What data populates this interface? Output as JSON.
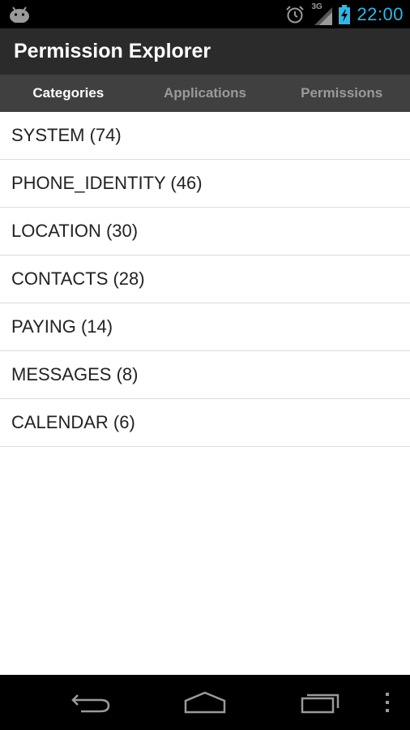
{
  "status_bar": {
    "time": "22:00",
    "network_label": "3G",
    "icons": [
      "android-icon",
      "alarm-icon",
      "signal-icon",
      "battery-charging-icon"
    ],
    "time_color": "#33b5e5"
  },
  "action_bar": {
    "title": "Permission Explorer",
    "background": "#2b2b2b"
  },
  "tabs": [
    {
      "label": "Categories",
      "active": true
    },
    {
      "label": "Applications",
      "active": false
    },
    {
      "label": "Permissions",
      "active": false
    }
  ],
  "categories": [
    {
      "label": "SYSTEM (74)"
    },
    {
      "label": "PHONE_IDENTITY (46)"
    },
    {
      "label": "LOCATION (30)"
    },
    {
      "label": "CONTACTS (28)"
    },
    {
      "label": "PAYING (14)"
    },
    {
      "label": "MESSAGES (8)"
    },
    {
      "label": "CALENDAR (6)"
    }
  ],
  "nav_bar": {
    "buttons": [
      "back-icon",
      "home-icon",
      "recent-apps-icon",
      "overflow-menu-icon"
    ]
  }
}
